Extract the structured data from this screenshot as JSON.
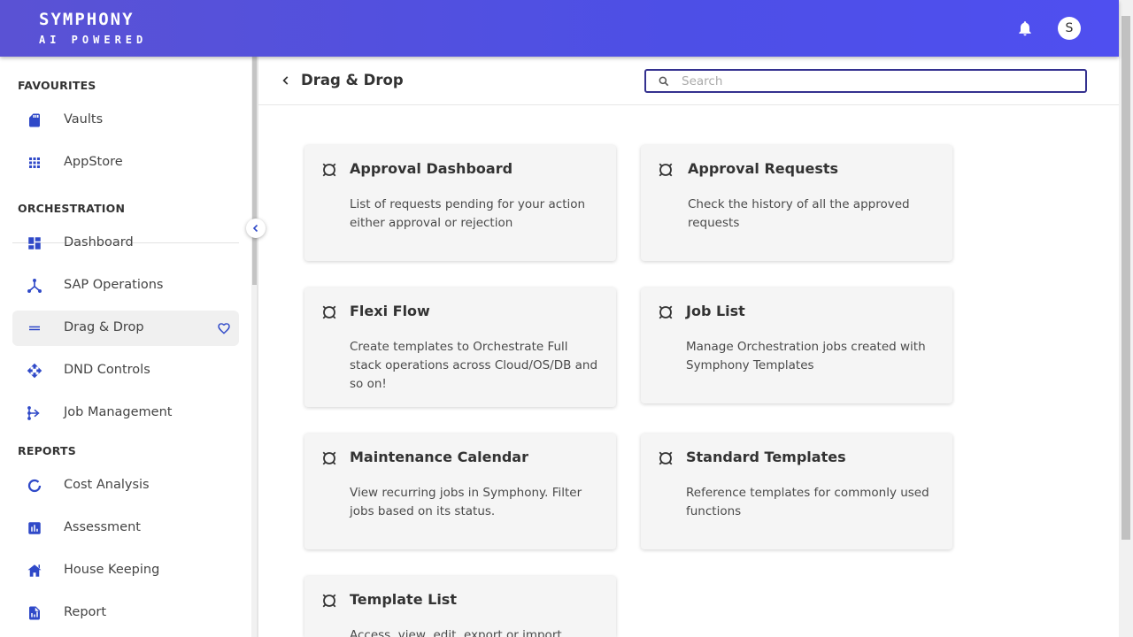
{
  "header": {
    "brand_name": "SYMPHONY",
    "brand_tagline": "AI POWERED",
    "notification_icon": "bell-icon",
    "avatar_letter": "S"
  },
  "colors": {
    "header_gradient_start": "#5a52d4",
    "header_gradient_end": "#4f4ff0",
    "accent": "#2f49c8",
    "search_border": "#34318f",
    "card_bg": "#f5f5f5",
    "active_item_bg": "#f0f0f0"
  },
  "sidebar": {
    "sections": [
      {
        "title": "FAVOURITES",
        "items": [
          {
            "label": "Vaults",
            "icon": "sd-card-icon"
          },
          {
            "label": "AppStore",
            "icon": "apps-grid-icon"
          }
        ]
      },
      {
        "title": "ORCHESTRATION",
        "items": [
          {
            "label": "Dashboard",
            "icon": "dashboard-icon"
          },
          {
            "label": "SAP Operations",
            "icon": "hub-icon"
          },
          {
            "label": "Drag & Drop",
            "icon": "drag-handle-icon",
            "active": true,
            "favourite": true
          },
          {
            "label": "DND Controls",
            "icon": "move-arrows-icon"
          },
          {
            "label": "Job Management",
            "icon": "schema-icon"
          }
        ]
      },
      {
        "title": "REPORTS",
        "items": [
          {
            "label": "Cost Analysis",
            "icon": "donut-icon"
          },
          {
            "label": "Assessment",
            "icon": "bar-chart-icon"
          },
          {
            "label": "House Keeping",
            "icon": "house-icon"
          },
          {
            "label": "Report",
            "icon": "report-icon"
          }
        ]
      }
    ]
  },
  "main": {
    "page_title": "Drag & Drop",
    "search": {
      "placeholder": "Search",
      "value": ""
    },
    "cards": [
      {
        "title": "Approval Dashboard",
        "description": "List of requests pending for your action either approval or rejection"
      },
      {
        "title": "Approval Requests",
        "description": "Check the history of all the approved requests"
      },
      {
        "title": "Flexi Flow",
        "description": "Create templates to Orchestrate Full stack operations across Cloud/OS/DB and so on!"
      },
      {
        "title": "Job List",
        "description": "Manage Orchestration jobs created with Symphony Templates"
      },
      {
        "title": "Maintenance Calendar",
        "description": "View recurring jobs in Symphony. Filter jobs based on its status."
      },
      {
        "title": "Standard Templates",
        "description": "Reference templates for commonly used functions"
      },
      {
        "title": "Template List",
        "description": "Access, view, edit, export or import"
      }
    ]
  }
}
